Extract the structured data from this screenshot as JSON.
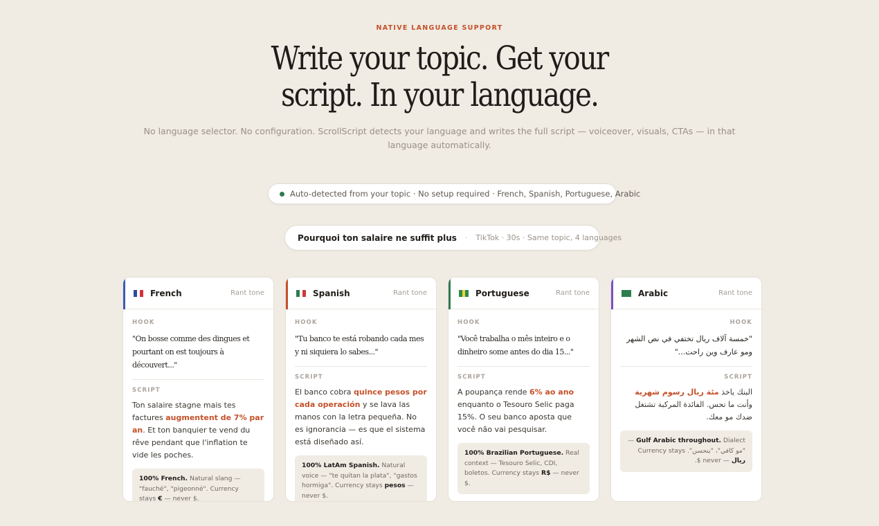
{
  "eyebrow": "NATIVE LANGUAGE SUPPORT",
  "headline": {
    "line1": "Write your topic. Get your",
    "line2": "script. In your language."
  },
  "subtitle": "No language selector. No configuration. ScrollScript detects your language and writes the full script — voiceover, visuals, CTAs — in that language automatically.",
  "detect_pill": "Auto-detected from your topic · No setup required · French, Spanish, Portuguese, Arabic",
  "topic_pill": {
    "title": "Pourquoi ton salaire ne suffit plus",
    "separator": "·",
    "meta": "TikTok · 30s · Same topic, 4 languages"
  },
  "cards": [
    {
      "lang": "French",
      "tone": "Rant tone",
      "accent": "#3b5bb8",
      "flag_colors": [
        "#2b4aa3",
        "#ffffff",
        "#d7303a"
      ],
      "hook_label": "HOOK",
      "hook": "\"On bosse comme des dingues et pourtant on est toujours à découvert...\"",
      "script_label": "SCRIPT",
      "script_pre": "Ton salaire stagne mais tes factures ",
      "script_hl": "augmentent de 7% par an",
      "script_post": ". Et ton banquier te vend du rêve pendant que l'inflation te vide les poches.",
      "note_bold": "100% French.",
      "note_pre": " Natural slang — \"fauché\", \"pigeonné\". Currency stays ",
      "note_bold2": "€",
      "note_post": " — never $."
    },
    {
      "lang": "Spanish",
      "tone": "Rant tone",
      "accent": "#c4512a",
      "flag_colors": [
        "#2d7d4e",
        "#ffffff",
        "#cf3a3a"
      ],
      "hook_label": "HOOK",
      "hook": "\"Tu banco te está robando cada mes y ni siquiera lo sabes...\"",
      "script_label": "SCRIPT",
      "script_pre": "El banco cobra ",
      "script_hl": "quince pesos por cada operación",
      "script_post": " y se lava las manos con la letra pequeña. No es ignorancia — es que el sistema está diseñado así.",
      "note_bold": "100% LatAm Spanish.",
      "note_pre": " Natural voice — \"te quitan la plata\", \"gastos hormiga\". Currency stays ",
      "note_bold2": "pesos",
      "note_post": " — never $."
    },
    {
      "lang": "Portuguese",
      "tone": "Rant tone",
      "accent": "#2f7a4f",
      "flag_colors": [
        "#2d8b4e",
        "#f2d13a",
        "#2d8b4e"
      ],
      "hook_label": "HOOK",
      "hook": "\"Você trabalha o mês inteiro e o dinheiro some antes do dia 15...\"",
      "script_label": "SCRIPT",
      "script_pre": "A poupança rende ",
      "script_hl": "6% ao ano",
      "script_post": " enquanto o Tesouro Selic paga 15%. O seu banco aposta que você não vai pesquisar.",
      "note_bold": "100% Brazilian Portuguese.",
      "note_pre": " Real context — Tesouro Selic, CDI, boletos. Currency stays ",
      "note_bold2": "R$",
      "note_post": " — never $."
    },
    {
      "lang": "Arabic",
      "tone": "Rant tone",
      "accent": "#7a4fc4",
      "flag_colors": [
        "#2d7d4e",
        "#2d7d4e",
        "#2d7d4e"
      ],
      "hook_label": "HOOK",
      "hook": "\"خمسة آلاف ريال تختفي في نص الشهر ومو عارف وين راحت...\"",
      "script_label": "SCRIPT",
      "script_pre": "البنك ياخذ ",
      "script_hl": "مئة ريال رسوم شهرية",
      "script_post": " وأنت ما تحس. الفائدة المركبة تشتغل ضدك مو معك.",
      "note_bold": "Gulf Arabic throughout.",
      "note_pre": " Dialect — \"مو كافي\"، \"ينحسن\". Currency stays ",
      "note_bold2": "ريال",
      "note_post": " — never $."
    }
  ]
}
